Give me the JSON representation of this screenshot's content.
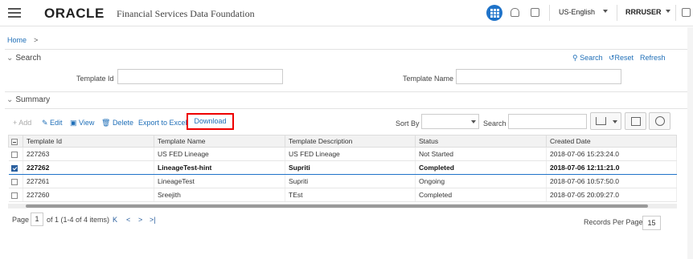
{
  "header": {
    "logo": "ORACLE",
    "app_name": "Financial Services Data Foundation",
    "language": "US-English",
    "user": "RRRUSER"
  },
  "breadcrumb": {
    "home": "Home",
    "separator": ">"
  },
  "search": {
    "title": "Search",
    "search_label": "Search",
    "reset_label": "Reset",
    "refresh_label": "Refresh",
    "template_id_label": "Template Id",
    "template_id_value": "",
    "template_name_label": "Template Name",
    "template_name_value": ""
  },
  "summary": {
    "title": "Summary",
    "toolbar": {
      "add": "Add",
      "edit": "Edit",
      "view": "View",
      "delete": "Delete",
      "export": "Export to Excel",
      "download": "Download"
    },
    "sort_by_label": "Sort By",
    "sort_by_value": "",
    "search_label": "Search",
    "search_value": ""
  },
  "table": {
    "columns": [
      "Template Id",
      "Template Name",
      "Template Description",
      "Status",
      "Created Date"
    ],
    "rows": [
      {
        "checked": false,
        "id": "227263",
        "name": "US FED Lineage",
        "desc": "US FED Lineage",
        "status": "Not Started",
        "date": "2018-07-06 15:23:24.0"
      },
      {
        "checked": true,
        "id": "227262",
        "name": "LineageTest-hint",
        "desc": "Supriti",
        "status": "Completed",
        "date": "2018-07-06 12:11:21.0"
      },
      {
        "checked": false,
        "id": "227261",
        "name": "LineageTest",
        "desc": "Supriti",
        "status": "Ongoing",
        "date": "2018-07-06 10:57:50.0"
      },
      {
        "checked": false,
        "id": "227260",
        "name": "Sreejith",
        "desc": "TEst",
        "status": "Completed",
        "date": "2018-07-05 20:09:27.0"
      }
    ]
  },
  "pager": {
    "page_label": "Page",
    "page_value": "1",
    "of_text": "of 1 (1-4 of 4 items)",
    "first": "K",
    "prev": "<",
    "next": ">",
    "last": ">|",
    "records_per_page_label": "Records Per Page",
    "records_per_page_value": "15"
  },
  "colors": {
    "accent": "#1f73c9",
    "highlight": "#e00000",
    "link": "#1f6fb8"
  }
}
